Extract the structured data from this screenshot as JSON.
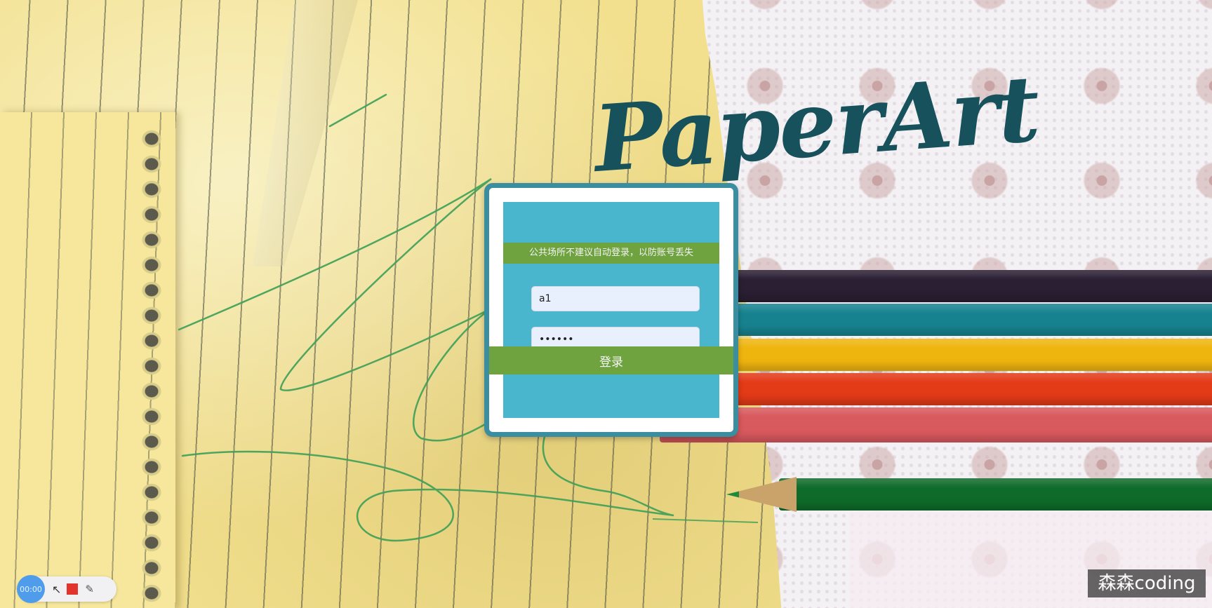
{
  "brand": {
    "title": "PaperArt"
  },
  "login": {
    "notice": "公共场所不建议自动登录，以防账号丢失",
    "username_value": "a1",
    "password_value": "••••••",
    "submit_label": "登录"
  },
  "recorder": {
    "time": "00:00"
  },
  "watermark": {
    "text": "森森coding"
  },
  "colors": {
    "dialog_frame": "#3b8da0",
    "panel": "#4ab6cd",
    "accent_green": "#6fa340",
    "brand_text": "#17525c"
  },
  "icons": [
    "cursor-icon",
    "stop-icon",
    "pen-icon"
  ]
}
